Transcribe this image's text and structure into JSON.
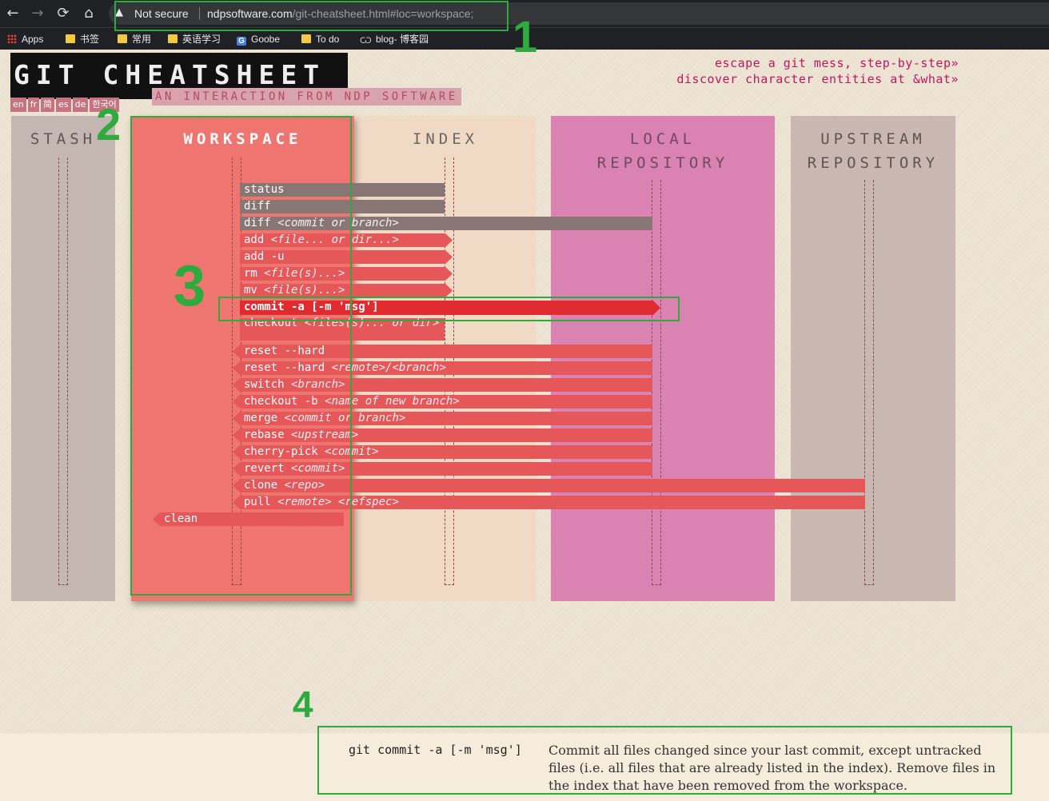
{
  "browser": {
    "nav": {
      "back": "←",
      "forward": "→",
      "reload": "⟳",
      "home": "⌂"
    },
    "security_icon": "▲",
    "security_label": "Not secure",
    "url_domain": "ndpsoftware.com",
    "url_path": "/git-cheatsheet.html#loc=workspace;",
    "bookmarks": [
      "Apps",
      "书签",
      "常用",
      "英语学习",
      "Goobe",
      "To do",
      "blog- 博客园"
    ]
  },
  "header": {
    "logo": "GIT CHEATSHEET",
    "subtitle": "AN INTERACTION FROM NDP SOFTWARE",
    "languages": [
      "en",
      "fr",
      "简",
      "es",
      "de",
      "한국어"
    ],
    "links": [
      "escape a git mess, step-by-step»",
      "discover character entities at &what»"
    ]
  },
  "columns": [
    {
      "id": "stash",
      "label": "STASH"
    },
    {
      "id": "workspace",
      "label": "WORKSPACE"
    },
    {
      "id": "index",
      "label": "INDEX"
    },
    {
      "id": "local",
      "label": "LOCAL\nREPOSITORY"
    },
    {
      "id": "upstream",
      "label": "UPSTREAM\nREPOSITORY"
    }
  ],
  "commands": [
    {
      "name": "status",
      "arg": ""
    },
    {
      "name": "diff",
      "arg": ""
    },
    {
      "name": "diff",
      "arg": "<commit or branch>"
    },
    {
      "name": "add",
      "arg": "<file... or dir...>"
    },
    {
      "name": "add -u",
      "arg": ""
    },
    {
      "name": "rm",
      "arg": "<file(s)...>"
    },
    {
      "name": "mv",
      "arg": "<file(s)...>"
    },
    {
      "name": "commit -a",
      "arg": "[-m 'msg']"
    },
    {
      "name": "checkout",
      "arg": "<files(s)... or dir>"
    },
    {
      "name": "reset --hard",
      "arg": ""
    },
    {
      "name": "reset --hard",
      "arg": "<remote>/<branch>"
    },
    {
      "name": "switch",
      "arg": "<branch>"
    },
    {
      "name": "checkout -b",
      "arg": "<name of new branch>"
    },
    {
      "name": "merge",
      "arg": "<commit or branch>"
    },
    {
      "name": "rebase",
      "arg": "<upstream>"
    },
    {
      "name": "cherry-pick",
      "arg": "<commit>"
    },
    {
      "name": "revert",
      "arg": "<commit>"
    },
    {
      "name": "clone",
      "arg": "<repo>"
    },
    {
      "name": "pull",
      "arg": "<remote> <refspec>"
    },
    {
      "name": "clean",
      "arg": ""
    }
  ],
  "selected_command": "commit -a",
  "doc": {
    "command": "git commit -a [-m 'msg']",
    "description": "Commit all files changed since your last commit, except untracked files (i.e. all files that are already listed in the index). Remove files in the index that have been removed from the workspace."
  },
  "annotations": [
    "1",
    "2",
    "3",
    "4"
  ],
  "colors": {
    "stash": "#c4b6b0",
    "workspace": "#ef7670",
    "index": "#f0dac6",
    "local": "#da82b2",
    "upstream": "#c9b8b2",
    "annotation": "#2eaa3e",
    "accent_link": "#c2185b"
  }
}
